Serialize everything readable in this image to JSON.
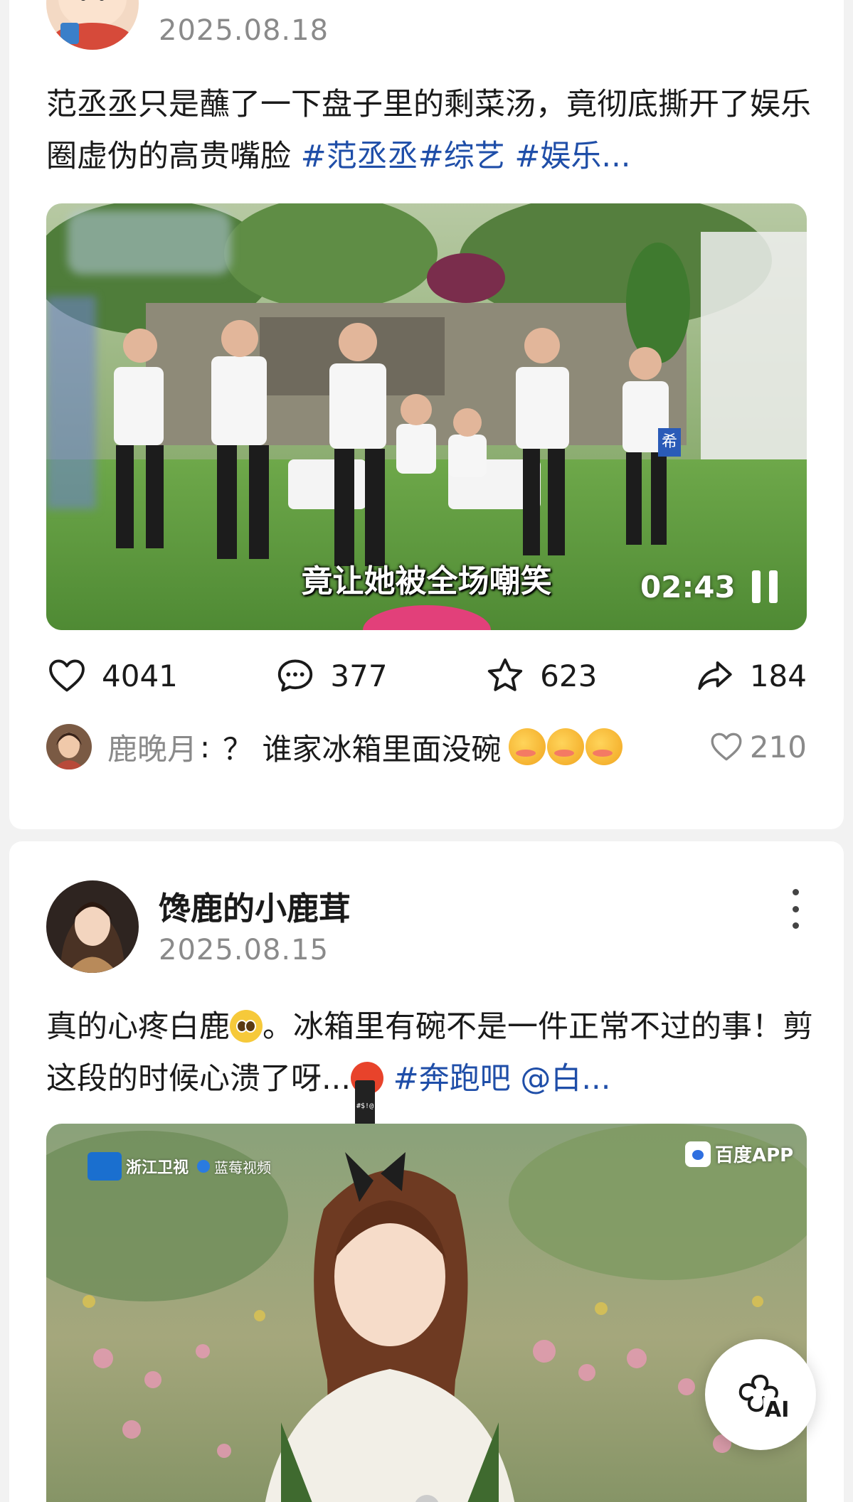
{
  "post1": {
    "date": "2025.08.18",
    "text": "范丞丞只是蘸了一下盘子里的剩菜汤，竟彻底撕开了娱乐圈虚伪的高贵嘴脸 ",
    "tags": "#范丞丞#综艺 #娱乐...",
    "video": {
      "subtitle": "竟让她被全场嘲笑",
      "time": "02:43",
      "corner_sign": "希"
    },
    "stats": {
      "likes": "4041",
      "comments": "377",
      "favorites": "623",
      "shares": "184"
    },
    "top_comment": {
      "author": "鹿晚月",
      "separator": ":",
      "text": "？ 谁家冰箱里面没碗",
      "likes": "210"
    }
  },
  "post2": {
    "username": "馋鹿的小鹿茸",
    "date": "2025.08.15",
    "text_a": "真的心疼白鹿",
    "text_b": "。冰箱里有碗不是一件正常不过的事！剪这段的时候心溃了呀...",
    "tags": " #奔跑吧 @白...",
    "video": {
      "channel_logo": "浙江卫视",
      "partner_logo": "蓝莓视频",
      "watermark": "百度APP"
    }
  },
  "fab": {
    "label": "AI"
  },
  "icons": {
    "like": "heart-icon",
    "comment": "speech-bubble-icon",
    "favorite": "star-icon",
    "share": "share-arrow-icon",
    "more": "vertical-dots-icon",
    "pause": "pause-icon"
  },
  "colors": {
    "hashtag": "#1f4ea8",
    "secondary_text": "#8a8a8a",
    "background": "#f2f2f2"
  }
}
